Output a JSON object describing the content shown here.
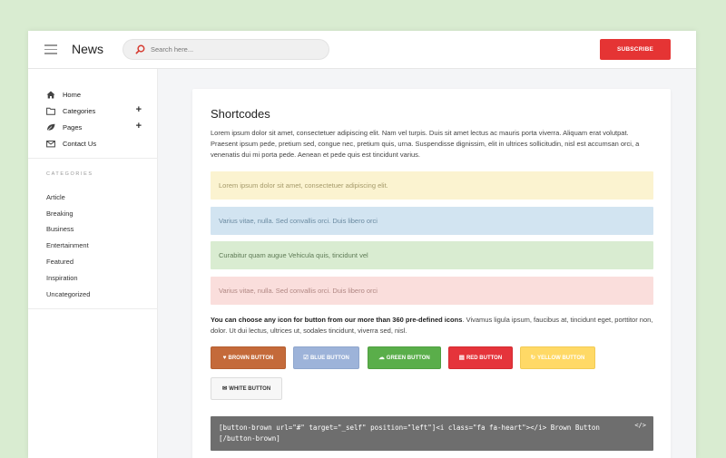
{
  "header": {
    "brand": "News",
    "search_placeholder": "Search here...",
    "subscribe_label": "SUBSCRIBE"
  },
  "sidebar": {
    "nav": [
      {
        "label": "Home",
        "icon": "home-icon",
        "expandable": false
      },
      {
        "label": "Categories",
        "icon": "folder-icon",
        "expandable": true,
        "toggle": "+"
      },
      {
        "label": "Pages",
        "icon": "leaf-icon",
        "expandable": true,
        "toggle": "+"
      },
      {
        "label": "Contact Us",
        "icon": "envelope-icon",
        "expandable": false
      }
    ],
    "categories_heading": "CATEGORIES",
    "categories": [
      "Article",
      "Breaking",
      "Business",
      "Entertainment",
      "Featured",
      "Inspiration",
      "Uncategorized"
    ]
  },
  "main": {
    "title": "Shortcodes",
    "intro": "Lorem ipsum dolor sit amet, consectetuer adipiscing elit. Nam vel turpis. Duis sit amet lectus ac mauris porta viverra. Aliquam erat volutpat. Praesent ipsum pede, pretium sed, congue nec, pretium quis, urna. Suspendisse dignissim, elit in ultrices sollicitudin, nisl est accumsan orci, a venenatis dui mi porta pede. Aenean et pede quis est tincidunt varius.",
    "alerts": [
      {
        "text": "Lorem ipsum dolor sit amet, consectetuer adipiscing elit.",
        "bg": "#fbf3d0",
        "color": "#a59a6a"
      },
      {
        "text": "Varius vitae, nulla. Sed convallis orci. Duis libero orci",
        "bg": "#d2e4f1",
        "color": "#6a8aa1"
      },
      {
        "text": "Curabitur quam augue Vehicula quis, tincidunt vel",
        "bg": "#d9ecd1",
        "color": "#5e7a55"
      },
      {
        "text": "Varius vitae, nulla. Sed convallis orci. Duis libero orci",
        "bg": "#fadedc",
        "color": "#b08783"
      }
    ],
    "buttons_intro_bold": "You can choose any icon for button from our more than 360 pre-defined icons",
    "buttons_intro_rest": ". Vivamus ligula ipsum, faucibus at, tincidunt eget, porttitor non, dolor. Ut dui lectus, ultrices ut, sodales tincidunt, viverra sed, nisl.",
    "buttons": [
      {
        "label": "BROWN BUTTON",
        "icon": "heart-icon",
        "glyph": "♥",
        "bg": "#c46a3a",
        "color": "#ffffff",
        "border": "#b55f30"
      },
      {
        "label": "BLUE BUTTON",
        "icon": "check-square-icon",
        "glyph": "☑",
        "bg": "#9db3d9",
        "color": "#ffffff",
        "border": "#8fa6cd"
      },
      {
        "label": "GREEN BUTTON",
        "icon": "cloud-download-icon",
        "glyph": "☁",
        "bg": "#5aae4a",
        "color": "#ffffff",
        "border": "#4f9f40"
      },
      {
        "label": "RED BUTTON",
        "icon": "document-icon",
        "glyph": "▤",
        "bg": "#e5343b",
        "color": "#ffffff",
        "border": "#d42a31"
      },
      {
        "label": "YELLOW BUTTON",
        "icon": "refresh-icon",
        "glyph": "↻",
        "bg": "#ffd966",
        "color": "#ffffff",
        "border": "#f2cb55"
      },
      {
        "label": "WHITE BUTTON",
        "icon": "envelope-icon",
        "glyph": "✉",
        "bg": "#f7f7f7",
        "color": "#333333",
        "border": "#dddddd"
      }
    ],
    "code_line1": "[button-brown url=\"#\" target=\"_self\" position=\"left\"]<i class=\"fa fa-heart\"></i> Brown Button",
    "code_line2": "[/button-brown]",
    "code_icon": "</>"
  }
}
